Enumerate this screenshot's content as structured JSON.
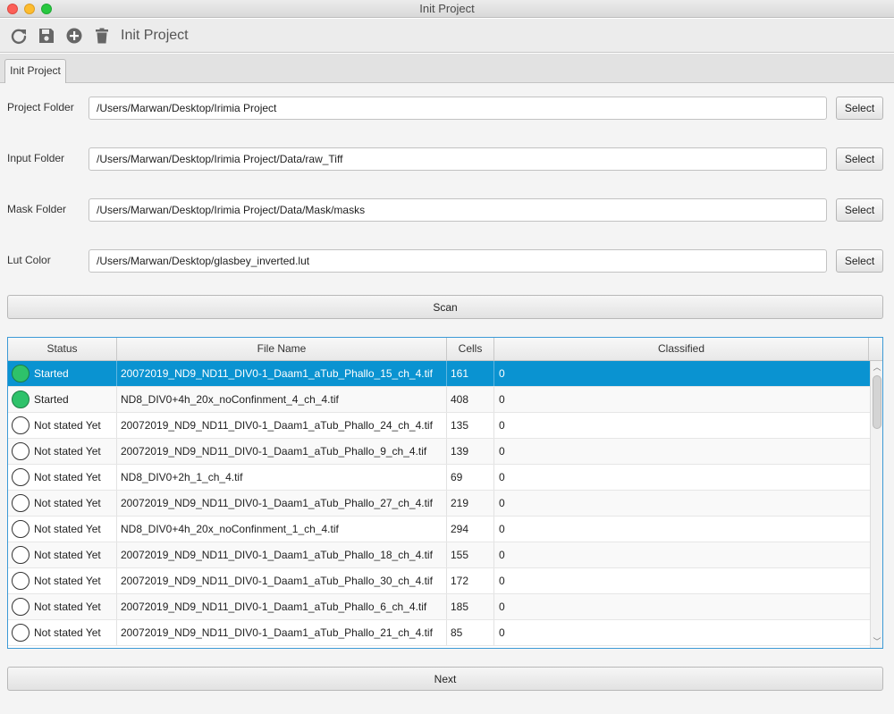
{
  "window": {
    "title": "Init Project"
  },
  "toolbar": {
    "title": "Init Project",
    "icons": [
      "refresh-icon",
      "save-icon",
      "add-icon",
      "trash-icon"
    ]
  },
  "tabs": [
    {
      "label": "Init Project"
    }
  ],
  "form": {
    "rows": [
      {
        "label": "Project Folder",
        "value": "/Users/Marwan/Desktop/Irimia Project",
        "button": "Select"
      },
      {
        "label": "Input Folder",
        "value": "/Users/Marwan/Desktop/Irimia Project/Data/raw_Tiff",
        "button": "Select"
      },
      {
        "label": "Mask Folder",
        "value": "/Users/Marwan/Desktop/Irimia Project/Data/Mask/masks",
        "button": "Select"
      },
      {
        "label": "Lut Color",
        "value": "/Users/Marwan/Desktop/glasbey_inverted.lut",
        "button": "Select"
      }
    ],
    "scan_label": "Scan"
  },
  "table": {
    "columns": [
      "Status",
      "File Name",
      "Cells",
      "Classified"
    ],
    "rows": [
      {
        "status": "Started",
        "started": true,
        "file": "20072019_ND9_ND11_DIV0-1_Daam1_aTub_Phallo_15_ch_4.tif",
        "cells": "161",
        "classified": "0"
      },
      {
        "status": "Started",
        "started": true,
        "file": "ND8_DIV0+4h_20x_noConfinment_4_ch_4.tif",
        "cells": "408",
        "classified": "0"
      },
      {
        "status": "Not stated Yet",
        "started": false,
        "file": "20072019_ND9_ND11_DIV0-1_Daam1_aTub_Phallo_24_ch_4.tif",
        "cells": "135",
        "classified": "0"
      },
      {
        "status": "Not stated Yet",
        "started": false,
        "file": "20072019_ND9_ND11_DIV0-1_Daam1_aTub_Phallo_9_ch_4.tif",
        "cells": "139",
        "classified": "0"
      },
      {
        "status": "Not stated Yet",
        "started": false,
        "file": "ND8_DIV0+2h_1_ch_4.tif",
        "cells": "69",
        "classified": "0"
      },
      {
        "status": "Not stated Yet",
        "started": false,
        "file": "20072019_ND9_ND11_DIV0-1_Daam1_aTub_Phallo_27_ch_4.tif",
        "cells": "219",
        "classified": "0"
      },
      {
        "status": "Not stated Yet",
        "started": false,
        "file": "ND8_DIV0+4h_20x_noConfinment_1_ch_4.tif",
        "cells": "294",
        "classified": "0"
      },
      {
        "status": "Not stated Yet",
        "started": false,
        "file": "20072019_ND9_ND11_DIV0-1_Daam1_aTub_Phallo_18_ch_4.tif",
        "cells": "155",
        "classified": "0"
      },
      {
        "status": "Not stated Yet",
        "started": false,
        "file": "20072019_ND9_ND11_DIV0-1_Daam1_aTub_Phallo_30_ch_4.tif",
        "cells": "172",
        "classified": "0"
      },
      {
        "status": "Not stated Yet",
        "started": false,
        "file": "20072019_ND9_ND11_DIV0-1_Daam1_aTub_Phallo_6_ch_4.tif",
        "cells": "185",
        "classified": "0"
      },
      {
        "status": "Not stated Yet",
        "started": false,
        "file": "20072019_ND9_ND11_DIV0-1_Daam1_aTub_Phallo_21_ch_4.tif",
        "cells": "85",
        "classified": "0"
      }
    ],
    "selected_index": 0
  },
  "footer": {
    "next_label": "Next"
  },
  "colors": {
    "selection": "#0a93d1",
    "started": "#2ec26a",
    "table_border": "#3c9ad6"
  }
}
